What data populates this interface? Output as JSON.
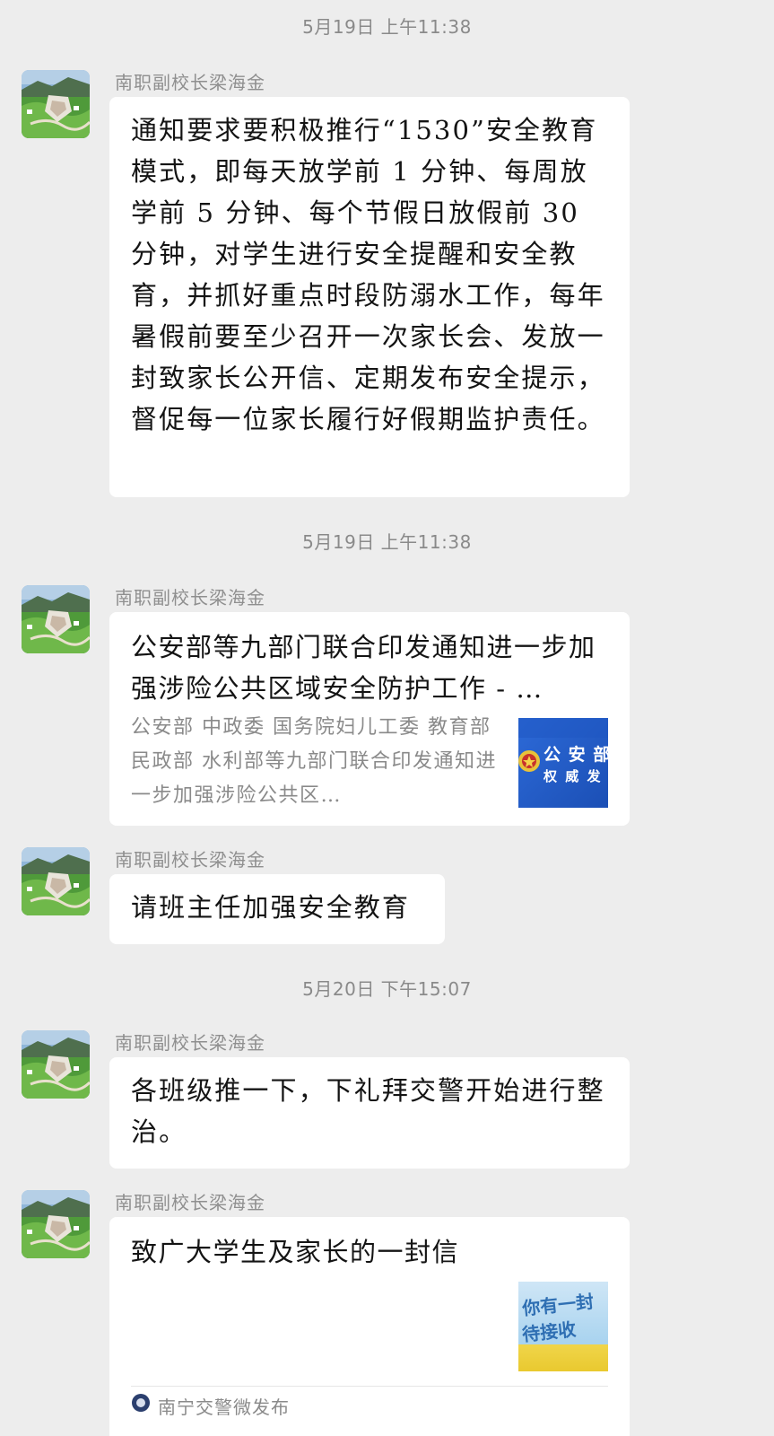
{
  "chat": {
    "timestamps": [
      "5月19日 上午11:38",
      "5月19日 上午11:38",
      "5月20日 下午15:07"
    ],
    "sender_name": "南职副校长梁海金",
    "messages": [
      {
        "type": "text",
        "text": "通知要求要积极推行“1530”安全教育模式，即每天放学前 1 分钟、每周放学前 5 分钟、每个节假日放假前 30 分钟，对学生进行安全提醒和安全教育，并抓好重点时段防溺水工作，每年暑假前要至少召开一次家长会、发放一封致家长公开信、定期发布安全提示，督促每一位家长履行好假期监护责任。"
      },
      {
        "type": "link",
        "title": "公安部等九部门联合印发通知进一步加强涉险公共区域安全防护工作 - …",
        "description": "公安部 中政委 国务院妇儿工委 教育部 民政部 水利部等九部门联合印发通知进一步加强涉险公共区…",
        "thumb_text_1": "公 安 部",
        "thumb_text_2": "权 威 发"
      },
      {
        "type": "text",
        "text": "请班主任加强安全教育"
      },
      {
        "type": "text",
        "text": "各班级推一下，下礼拜交警开始进行整治。"
      },
      {
        "type": "link",
        "title": "致广大学生及家长的一封信",
        "thumb_text_1": "你有一封",
        "thumb_text_2": "待接收",
        "source": "南宁交警微发布"
      }
    ]
  },
  "colors": {
    "background": "#ededed",
    "bubble": "#ffffff",
    "text": "#141414",
    "muted": "#8a8a8a",
    "police_blue": "#2d6ad8",
    "letter_yellow": "#e9c92f"
  }
}
